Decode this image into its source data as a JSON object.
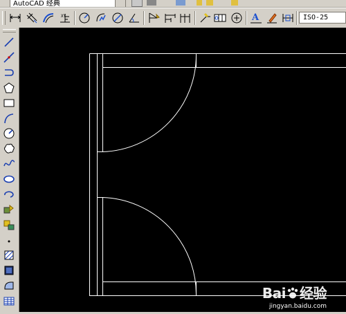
{
  "layer_combo": {
    "value": "AutoCAD 经典"
  },
  "dim_style": {
    "value": "ISO-25"
  },
  "toolbar_tools": [
    "linear-dimension",
    "aligned-dimension",
    "arc-length-dimension",
    "ordinate-dimension",
    "radius-dimension",
    "jogged-dimension",
    "diameter-dimension",
    "angular-dimension",
    "quick-dimension",
    "baseline-dimension",
    "continue-dimension",
    "quick-leader",
    "tolerance",
    "center-mark",
    "dimension-edit",
    "dimension-text-edit",
    "dimension-update"
  ],
  "draw_tools": [
    "line",
    "construction-line",
    "polyline",
    "polygon",
    "rectangle",
    "arc",
    "circle",
    "revision-cloud",
    "spline",
    "ellipse",
    "ellipse-arc",
    "insert-block",
    "make-block",
    "point",
    "hatch",
    "gradient",
    "region",
    "table"
  ],
  "watermark": {
    "brand": "Bai",
    "brand2": "经验",
    "url": "jingyan.baidu.com"
  },
  "colors": {
    "canvas": "#000000",
    "linework": "#ffffff",
    "chrome": "#d4d0c8"
  }
}
